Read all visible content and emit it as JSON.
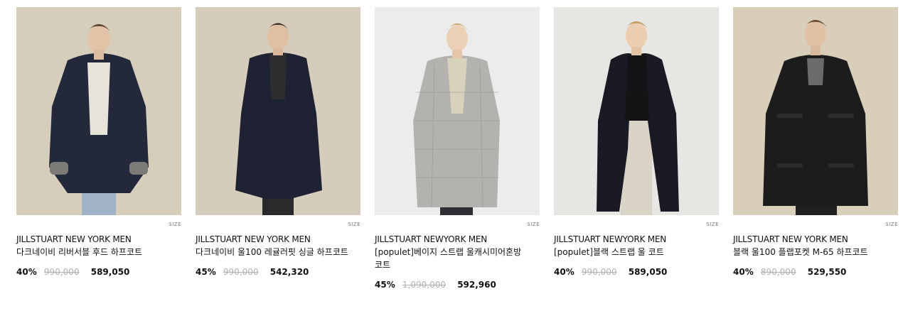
{
  "products": [
    {
      "brand": "JILLSTUART NEW YORK MEN",
      "name": "다크네이비 리버서블 후드 하프코트",
      "discount": "40%",
      "original_price": "990,000",
      "sale_price": "589,050",
      "size_label": "SIZE",
      "image": {
        "bg": "#d6cdbb",
        "coat": "#23293a",
        "inner": "#e8e3d8",
        "pants": "#9fb2c6"
      }
    },
    {
      "brand": "JILLSTUART NEW YORK MEN",
      "name": "다크네이비 울100 레귤러핏 싱글 하프코트",
      "discount": "45%",
      "original_price": "990,000",
      "sale_price": "542,320",
      "size_label": "SIZE",
      "image": {
        "bg": "#d5ccbb",
        "coat": "#1f2232",
        "inner": "#2d2d30",
        "pants": "#2a2a2c"
      }
    },
    {
      "brand": "JILLSTUART NEWYORK MEN",
      "name": "[populet]베이지 스트랩 울캐시미어혼방 코트",
      "discount": "45%",
      "original_price": "1,090,000",
      "sale_price": "592,960",
      "size_label": "SIZE",
      "image": {
        "bg": "#ececec",
        "coat": "#b3b2ae",
        "inner": "#d8d2bd",
        "pants": "#2f2f33"
      }
    },
    {
      "brand": "JILLSTUART NEWYORK MEN",
      "name": "[populet]블랙 스트랩 울 코트",
      "discount": "40%",
      "original_price": "990,000",
      "sale_price": "589,050",
      "size_label": "SIZE",
      "image": {
        "bg": "#e7e6e2",
        "coat": "#191a23",
        "inner": "#141416",
        "pants": "#d9d4c6"
      }
    },
    {
      "brand": "JILLSTUART NEW YORK MEN",
      "name": "블랙 울100 플랩포켓 M-65 하프코트",
      "discount": "40%",
      "original_price": "890,000",
      "sale_price": "529,550",
      "size_label": "SIZE",
      "image": {
        "bg": "#d8ceba",
        "coat": "#1c1c1d",
        "inner": "#6b6b6e",
        "pants": "#1f1f20"
      }
    }
  ]
}
